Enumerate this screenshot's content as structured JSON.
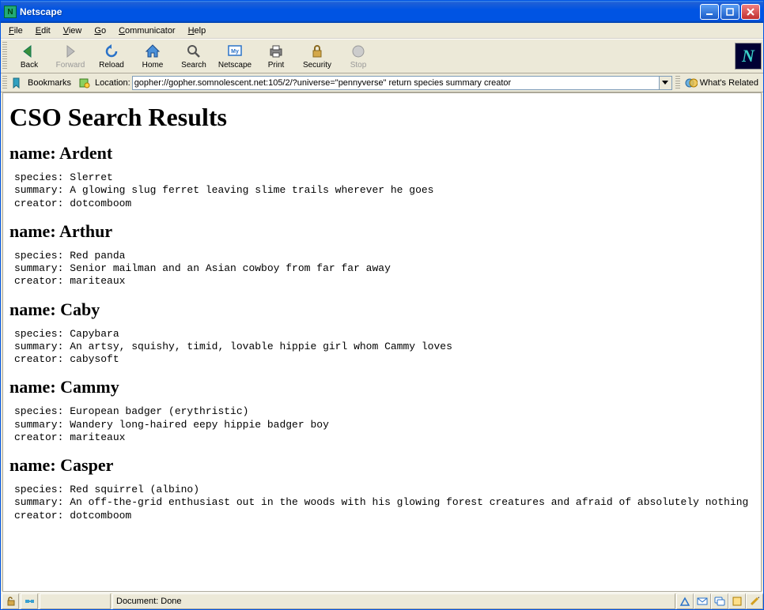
{
  "window": {
    "title": "Netscape"
  },
  "menu": {
    "items": [
      "File",
      "Edit",
      "View",
      "Go",
      "Communicator",
      "Help"
    ]
  },
  "toolbar": {
    "buttons": [
      {
        "name": "back-button",
        "label": "Back",
        "enabled": true
      },
      {
        "name": "forward-button",
        "label": "Forward",
        "enabled": false
      },
      {
        "name": "reload-button",
        "label": "Reload",
        "enabled": true
      },
      {
        "name": "home-button",
        "label": "Home",
        "enabled": true
      },
      {
        "name": "search-button",
        "label": "Search",
        "enabled": true
      },
      {
        "name": "netscape-button",
        "label": "Netscape",
        "enabled": true
      },
      {
        "name": "print-button",
        "label": "Print",
        "enabled": true
      },
      {
        "name": "security-button",
        "label": "Security",
        "enabled": true
      },
      {
        "name": "stop-button",
        "label": "Stop",
        "enabled": false
      }
    ],
    "logo_letter": "N"
  },
  "location": {
    "bookmarks_label": "Bookmarks",
    "location_label": "Location:",
    "url": "gopher://gopher.somnolescent.net:105/2/?universe=\"pennyverse\" return species summary creator",
    "whats_related": "What's Related"
  },
  "page": {
    "title": "CSO Search Results",
    "labels": {
      "name": "name",
      "species": "species",
      "summary": "summary",
      "creator": "creator"
    },
    "results": [
      {
        "name": "Ardent",
        "species": "Slerret",
        "summary": "A glowing slug ferret leaving slime trails wherever he goes",
        "creator": "dotcomboom"
      },
      {
        "name": "Arthur",
        "species": "Red panda",
        "summary": "Senior mailman and an Asian cowboy from far far away",
        "creator": "mariteaux"
      },
      {
        "name": "Caby",
        "species": "Capybara",
        "summary": "An artsy, squishy, timid, lovable hippie girl whom Cammy loves",
        "creator": "cabysoft"
      },
      {
        "name": "Cammy",
        "species": "European badger (erythristic)",
        "summary": "Wandery long-haired eepy hippie badger boy",
        "creator": "mariteaux"
      },
      {
        "name": "Casper",
        "species": "Red squirrel (albino)",
        "summary": "An off-the-grid enthusiast out in the woods with his glowing forest creatures and afraid of absolutely nothing",
        "creator": "dotcomboom"
      }
    ]
  },
  "status": {
    "document": "Document: Done"
  }
}
